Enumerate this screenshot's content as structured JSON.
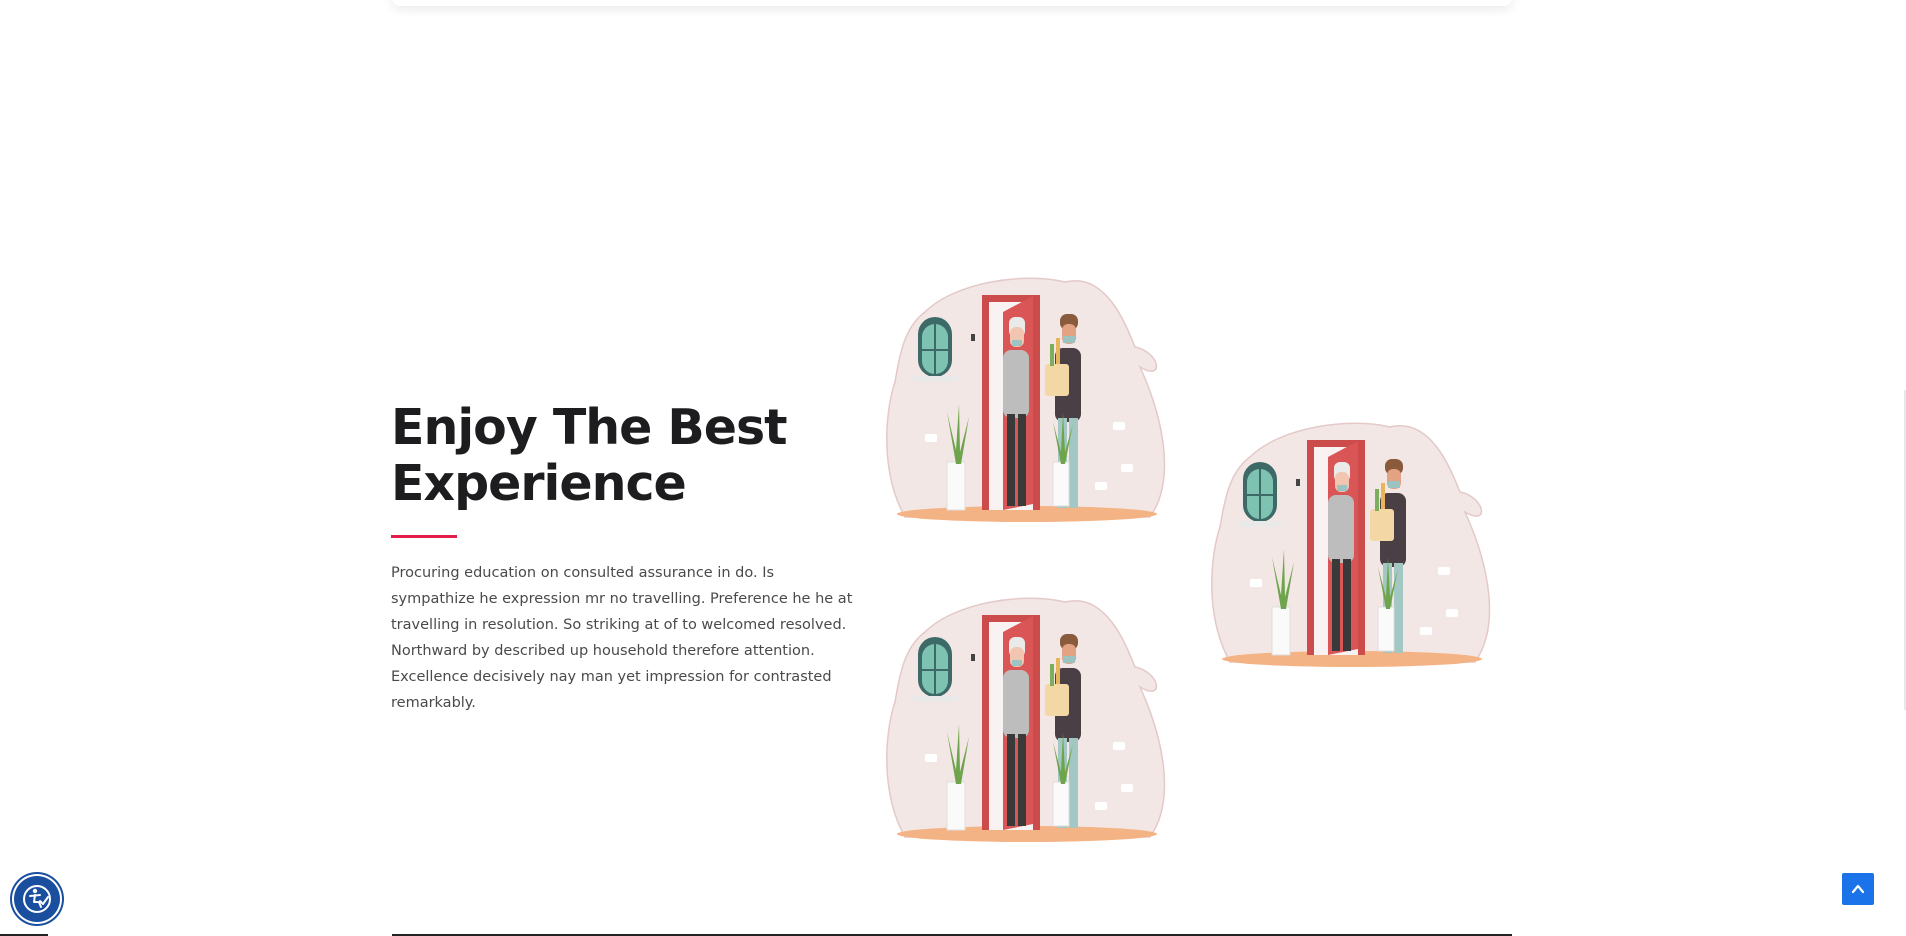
{
  "feature": {
    "heading_line1": "Enjoy The Best",
    "heading_line2": "Experience",
    "paragraph": "Procuring education on consulted assurance in do. Is sympathize he expression mr no travelling. Preference he he at travelling in resolution. So striking at of to welcomed resolved. Northward by described up household therefore attention. Excellence decisively nay man yet impression for contrasted remarkably.",
    "accent_color": "#e21d4b"
  },
  "illustrations": [
    {
      "icon": "grocery-delivery-illustration"
    },
    {
      "icon": "grocery-delivery-illustration"
    },
    {
      "icon": "grocery-delivery-illustration"
    }
  ],
  "controls": {
    "scroll_top_icon": "chevron-up-icon",
    "accessibility_icon": "accessibility-icon",
    "accent": "#1a73e8"
  }
}
